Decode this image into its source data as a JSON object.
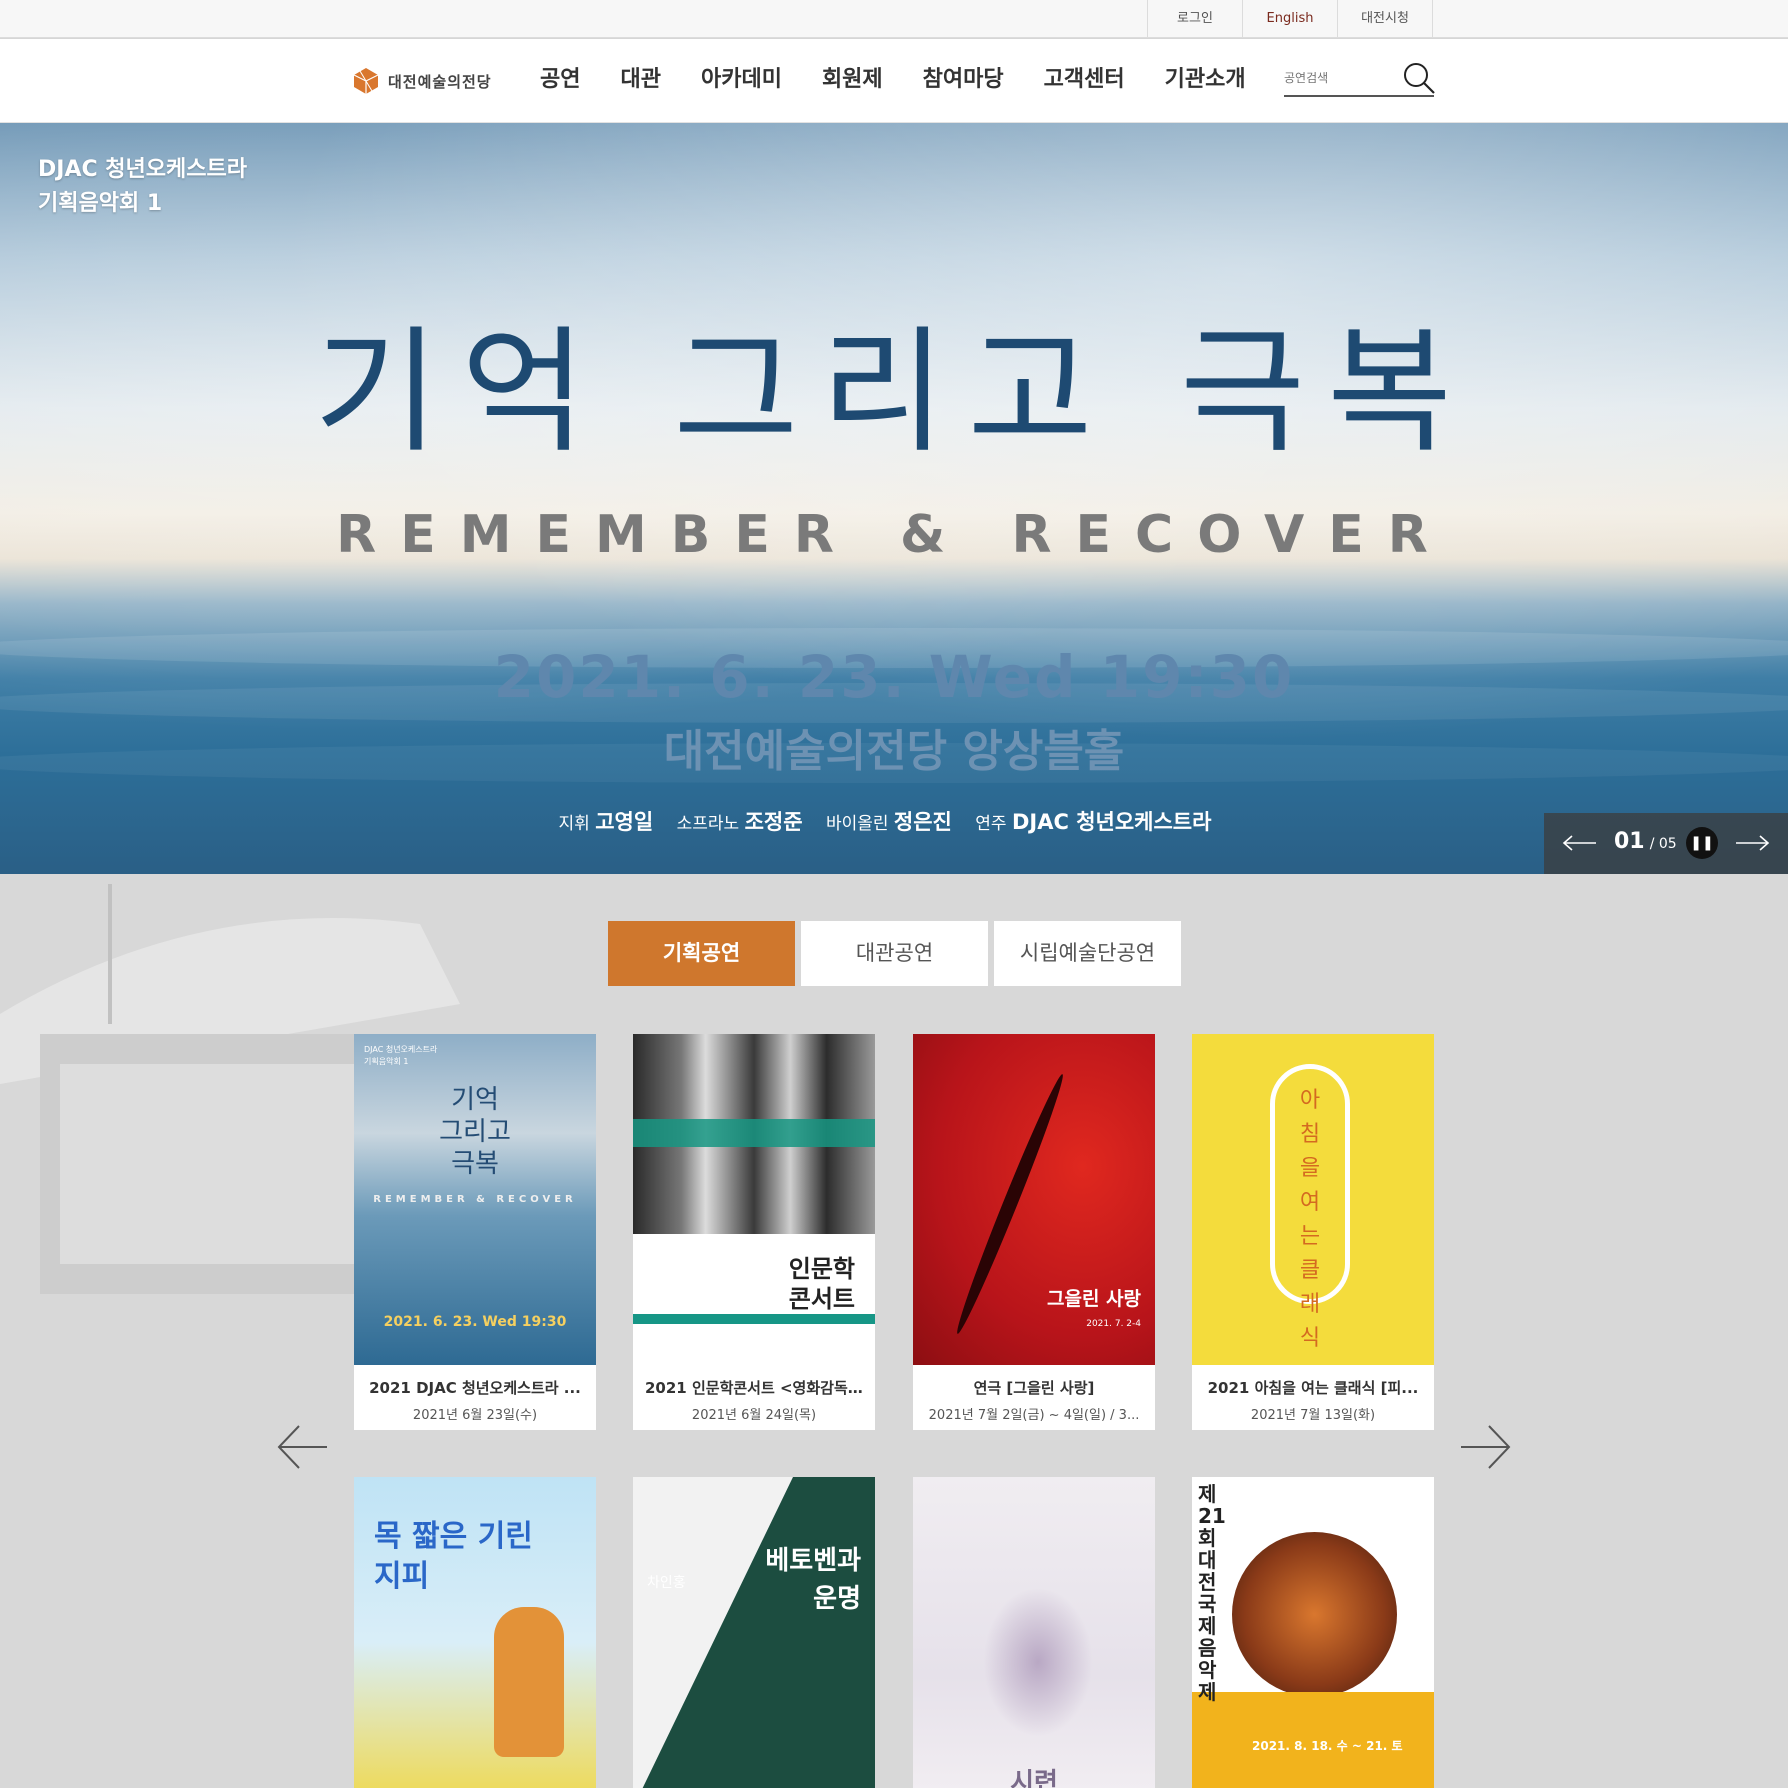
{
  "util": {
    "links": [
      "로그인",
      "English",
      "대전시청"
    ]
  },
  "nav": {
    "logo": "대전예술의전당",
    "menu": [
      "공연",
      "대관",
      "아카데미",
      "회원제",
      "참여마당",
      "고객센터",
      "기관소개"
    ],
    "search_placeholder": "공연검색"
  },
  "hero": {
    "kicker_line1": "DJAC 청년오케스트라",
    "kicker_line2": "기획음악회 1",
    "title": "기억 그리고 극복",
    "subtitle": "REMEMBER & RECOVER",
    "date": "2021. 6. 23. Wed 19:30",
    "venue": "대전예술의전당 앙상블홀",
    "credits": [
      {
        "role": "지휘",
        "name": "고영일"
      },
      {
        "role": "소프라노",
        "name": "조정준"
      },
      {
        "role": "바이올린",
        "name": "정은진"
      },
      {
        "role": "연주",
        "name": "DJAC 청년오케스트라"
      }
    ],
    "slide_current": "01",
    "slide_total": "/ 05"
  },
  "tabs": [
    "기획공연",
    "대관공연",
    "시립예술단공연"
  ],
  "cards": [
    {
      "title": "2021 DJAC 청년오케스트라 ...",
      "date": "2021년 6월 23일(수)",
      "poster": {
        "kicker": "DJAC 청년오케스트라\n기획음악회 1",
        "title": "기억\n그리고\n극복",
        "sub": "REMEMBER & RECOVER",
        "date": "2021. 6. 23. Wed 19:30"
      }
    },
    {
      "title": "2021 인문학콘서트 <영화감독...",
      "date": "2021년 6월 24일(목)",
      "poster": {
        "title": "인문학\n콘서트"
      }
    },
    {
      "title": "연극 [그을린 사랑]",
      "date": "2021년 7월 2일(금) ~ 4일(일) / 3...",
      "poster": {
        "title": "그을린 사랑",
        "date": "2021. 7. 2-4"
      }
    },
    {
      "title": "2021 아침을 여는 클래식 [피...",
      "date": "2021년 7월 13일(화)",
      "poster": {
        "title": "아침을여는클래식"
      }
    },
    {
      "title": "",
      "date": "",
      "poster": {
        "title": "목 짧은 기린\n지피"
      }
    },
    {
      "title": "",
      "date": "",
      "poster": {
        "title": "베토벤과\n운명",
        "name": "차인홍"
      }
    },
    {
      "title": "",
      "date": "",
      "poster": {
        "title": "시련"
      }
    },
    {
      "title": "",
      "date": "",
      "poster": {
        "title": "제21회 대전국제음악제",
        "date": "2021. 8. 18. 수 ~ 21. 토"
      }
    }
  ],
  "colors": {
    "accent": "#cf772d",
    "nav_text": "#333333",
    "hero_title": "#1e4a72"
  }
}
